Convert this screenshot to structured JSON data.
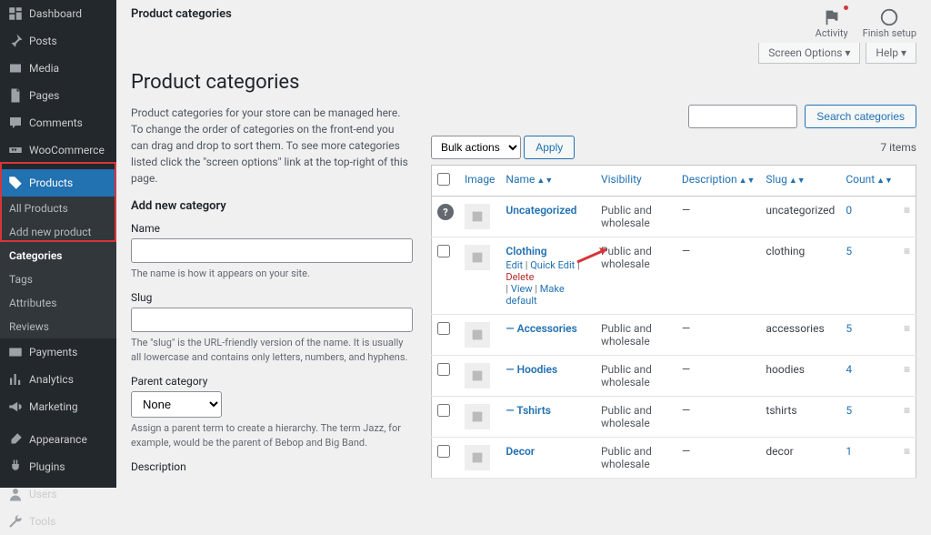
{
  "sidebar": {
    "items": [
      {
        "icon": "dash",
        "label": "Dashboard"
      },
      {
        "icon": "pin",
        "label": "Posts"
      },
      {
        "icon": "media",
        "label": "Media"
      },
      {
        "icon": "page",
        "label": "Pages"
      },
      {
        "icon": "comment",
        "label": "Comments"
      },
      {
        "icon": "woo",
        "label": "WooCommerce"
      },
      {
        "icon": "tag",
        "label": "Products"
      },
      {
        "icon": "card",
        "label": "Payments"
      },
      {
        "icon": "chart",
        "label": "Analytics"
      },
      {
        "icon": "mega",
        "label": "Marketing"
      },
      {
        "icon": "brush",
        "label": "Appearance"
      },
      {
        "icon": "plug",
        "label": "Plugins"
      },
      {
        "icon": "user",
        "label": "Users"
      },
      {
        "icon": "wrench",
        "label": "Tools"
      }
    ],
    "sub": [
      "All Products",
      "Add new product",
      "Categories",
      "Tags",
      "Attributes",
      "Reviews"
    ],
    "sub_current": 2,
    "current": 6
  },
  "top": {
    "breadcrumb": "Product categories",
    "activity": "Activity",
    "finish": "Finish setup",
    "screen_options": "Screen Options ▾",
    "help": "Help ▾"
  },
  "page_title": "Product categories",
  "intro": "Product categories for your store can be managed here. To change the order of categories on the front-end you can drag and drop to sort them. To see more categories listed click the \"screen options\" link at the top-right of this page.",
  "form": {
    "heading": "Add new category",
    "name": {
      "label": "Name",
      "help": "The name is how it appears on your site."
    },
    "slug": {
      "label": "Slug",
      "help": "The \"slug\" is the URL-friendly version of the name. It is usually all lowercase and contains only letters, numbers, and hyphens."
    },
    "parent": {
      "label": "Parent category",
      "selected": "None",
      "help": "Assign a parent term to create a hierarchy. The term Jazz, for example, would be the parent of Bebop and Big Band."
    },
    "description": {
      "label": "Description"
    }
  },
  "table": {
    "search_btn": "Search categories",
    "bulk": "Bulk actions",
    "apply": "Apply",
    "count": "7 items",
    "headers": {
      "image": "Image",
      "name": "Name",
      "visibility": "Visibility",
      "description": "Description",
      "slug": "Slug",
      "count": "Count"
    },
    "visibility_text": "Public and wholesale",
    "dash": "—",
    "rows": [
      {
        "q": true,
        "name": "Uncategorized",
        "slug": "uncategorized",
        "count": "0",
        "actions": false,
        "indent": ""
      },
      {
        "name": "Clothing",
        "slug": "clothing",
        "count": "5",
        "actions": true,
        "indent": ""
      },
      {
        "name": "Accessories",
        "slug": "accessories",
        "count": "5",
        "indent": "— "
      },
      {
        "name": "Hoodies",
        "slug": "hoodies",
        "count": "4",
        "indent": "— "
      },
      {
        "name": "Tshirts",
        "slug": "tshirts",
        "count": "5",
        "indent": "— "
      },
      {
        "name": "Decor",
        "slug": "decor",
        "count": "1",
        "indent": ""
      }
    ],
    "row_actions": {
      "edit": "Edit",
      "quick": "Quick Edit",
      "del": "Delete",
      "view": "View",
      "make": "Make default"
    }
  }
}
